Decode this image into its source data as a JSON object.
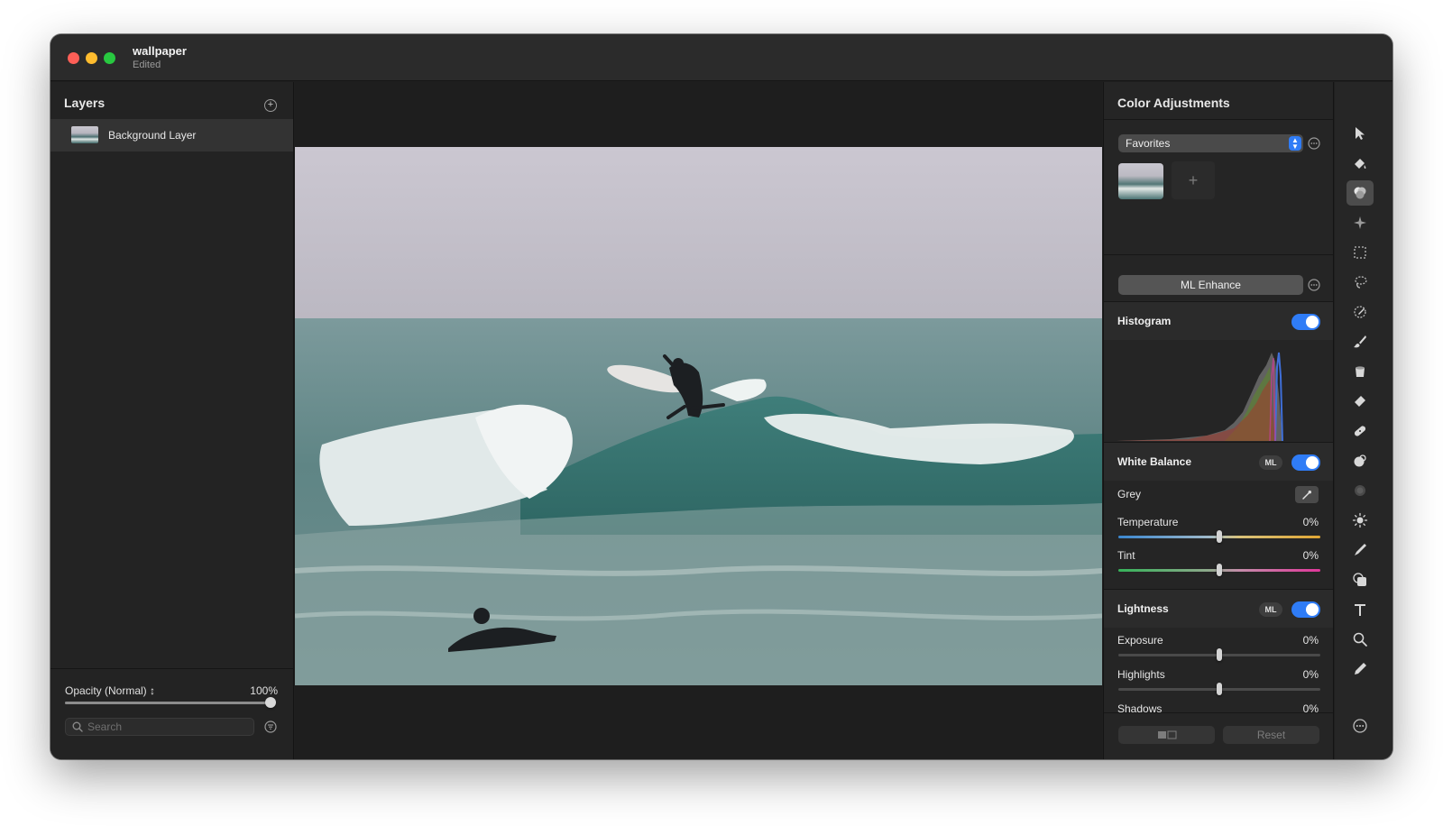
{
  "window": {
    "title": "wallpaper",
    "subtitle": "Edited"
  },
  "layers_panel": {
    "title": "Layers",
    "layers": [
      {
        "name": "Background Layer",
        "selected": true
      }
    ],
    "opacity_label": "Opacity (Normal) ↕",
    "opacity_value": "100%",
    "opacity_fraction": 1.0,
    "search_placeholder": "Search"
  },
  "canvas": {
    "image": "surfer riding a wave"
  },
  "adjustments": {
    "title": "Color Adjustments",
    "favorites": {
      "selected": "Favorites"
    },
    "ml_enhance_label": "ML Enhance",
    "histogram": {
      "title": "Histogram",
      "enabled": true
    },
    "white_balance": {
      "title": "White Balance",
      "ml_badge": "ML",
      "enabled": true,
      "grey_label": "Grey",
      "temperature": {
        "label": "Temperature",
        "value": "0%",
        "position": 0.5
      },
      "tint": {
        "label": "Tint",
        "value": "0%",
        "position": 0.5
      }
    },
    "lightness": {
      "title": "Lightness",
      "ml_badge": "ML",
      "enabled": true,
      "exposure": {
        "label": "Exposure",
        "value": "0%",
        "position": 0.5
      },
      "highlights": {
        "label": "Highlights",
        "value": "0%",
        "position": 0.5
      },
      "shadows": {
        "label": "Shadows",
        "value": "0%"
      }
    },
    "footer": {
      "reset_label": "Reset"
    }
  },
  "tools": [
    "pointer-icon",
    "paint-bucket-icon",
    "color-adjust-icon",
    "sparkle-icon",
    "rect-select-icon",
    "lasso-icon",
    "magic-wand-icon",
    "brush-icon",
    "fill-icon",
    "eraser-icon",
    "bandage-icon",
    "clone-icon",
    "blur-icon",
    "sun-icon",
    "pen-icon",
    "shape-icon",
    "text-icon",
    "zoom-icon",
    "pencil-icon"
  ],
  "colors": {
    "accent": "#2f7cf6",
    "window_bg": "#1f1f1f",
    "close": "#fe5f57",
    "minimize": "#febc2e",
    "zoom": "#28c840"
  }
}
